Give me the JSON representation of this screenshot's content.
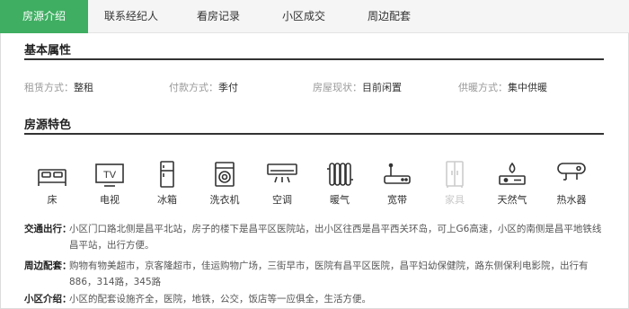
{
  "tabs": [
    {
      "label": "房源介绍",
      "active": true
    },
    {
      "label": "联系经纪人",
      "active": false
    },
    {
      "label": "看房记录",
      "active": false
    },
    {
      "label": "小区成交",
      "active": false
    },
    {
      "label": "周边配套",
      "active": false
    }
  ],
  "basic": {
    "title": "基本属性",
    "attributes": [
      {
        "key": "租赁方式：",
        "value": "整租"
      },
      {
        "key": "付款方式：",
        "value": "季付"
      },
      {
        "key": "房屋现状：",
        "value": "目前闲置"
      },
      {
        "key": "供暖方式：",
        "value": "集中供暖"
      }
    ]
  },
  "features": {
    "title": "房源特色",
    "items": [
      {
        "icon": "bed-icon",
        "label": "床",
        "available": true
      },
      {
        "icon": "tv-icon",
        "label": "电视",
        "available": true,
        "glyph": "TV"
      },
      {
        "icon": "fridge-icon",
        "label": "冰箱",
        "available": true
      },
      {
        "icon": "washer-icon",
        "label": "洗衣机",
        "available": true
      },
      {
        "icon": "air-conditioner-icon",
        "label": "空调",
        "available": true
      },
      {
        "icon": "radiator-icon",
        "label": "暖气",
        "available": true
      },
      {
        "icon": "router-icon",
        "label": "宽带",
        "available": true
      },
      {
        "icon": "wardrobe-icon",
        "label": "家具",
        "available": false
      },
      {
        "icon": "gas-stove-icon",
        "label": "天然气",
        "available": true
      },
      {
        "icon": "water-heater-icon",
        "label": "热水器",
        "available": true
      }
    ]
  },
  "info": {
    "traffic": {
      "key": "交通出行：",
      "value": "小区门口路北侧是昌平北站，房子的楼下是昌平区医院站，出小区往西是昌平西关环岛，可上G6高速，小区的南侧是昌平地铁线昌平站，出行方便。"
    },
    "surround": {
      "key": "周边配套：",
      "value": "购物有物美超市，京客隆超市，佳运购物广场，三街早市，医院有昌平区医院，昌平妇幼保健院，路东侧保利电影院，出行有886，314路，345路"
    },
    "community": {
      "key": "小区介绍：",
      "value": "小区的配套设施齐全，医院，地铁，公交，饭店等一应俱全，生活方便。"
    }
  },
  "colors": {
    "accent": "#3fae62",
    "icon": "#333333",
    "icon_disabled": "#cccccc"
  }
}
